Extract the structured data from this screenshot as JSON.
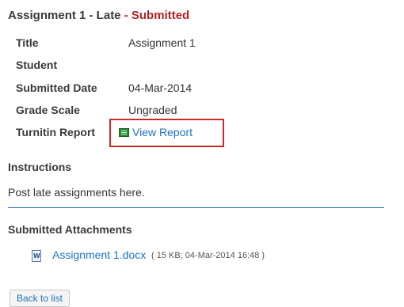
{
  "heading": {
    "prefix": "Assignment 1 - Late",
    "separator": " - ",
    "status": "Submitted"
  },
  "details": [
    {
      "label": "Title",
      "value": "Assignment 1"
    },
    {
      "label": "Student",
      "value": ""
    },
    {
      "label": "Submitted Date",
      "value": "04-Mar-2014"
    },
    {
      "label": "Grade Scale",
      "value": "Ungraded"
    },
    {
      "label": "Turnitin Report",
      "value": ""
    }
  ],
  "turnitin": {
    "link_text": "View Report",
    "icon": "report-icon"
  },
  "instructions": {
    "title": "Instructions",
    "text": "Post late assignments here."
  },
  "attachments": {
    "title": "Submitted Attachments",
    "items": [
      {
        "icon": "word-document-icon",
        "name": "Assignment 1.docx",
        "meta": "( 15 KB; 04-Mar-2014 16:48 )"
      }
    ]
  },
  "actions": {
    "back_label": "Back to list"
  },
  "colors": {
    "status": "#b22222",
    "link": "#1e73be",
    "highlight_box": "#cc2a2a"
  }
}
